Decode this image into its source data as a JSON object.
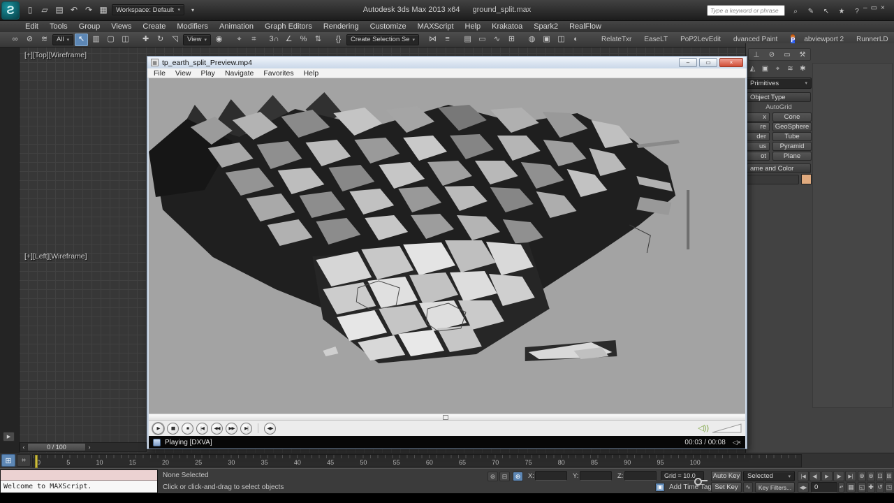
{
  "titlebar": {
    "app_title": "Autodesk 3ds Max  2013 x64",
    "filename": "ground_split.max",
    "workspace": "Workspace: Default",
    "search_placeholder": "Type a keyword or phrase"
  },
  "menubar": {
    "items": [
      "Edit",
      "Tools",
      "Group",
      "Views",
      "Create",
      "Modifiers",
      "Animation",
      "Graph Editors",
      "Rendering",
      "Customize",
      "MAXScript",
      "Help",
      "Krakatoa",
      "Spark2",
      "RealFlow"
    ]
  },
  "toolbar": {
    "filter_dropdown": "All",
    "coord_dropdown": "View",
    "selection_set_dropdown": "Create Selection Se",
    "plugins_left": [
      "RelateTxr",
      "EaseLT",
      "PoP2LevEdit",
      "dvanced Paint"
    ],
    "plugins_right": [
      "abviewport 2",
      "RunnerLD"
    ]
  },
  "viewport": {
    "top_label": "[+][Top][Wireframe]",
    "left_label": "[+][Left][Wireframe]",
    "time_slider_label": "0 / 100"
  },
  "trackbar": {
    "ticks": [
      "0",
      "5",
      "10",
      "15",
      "20",
      "25",
      "30",
      "35",
      "40",
      "45",
      "50",
      "55",
      "60",
      "65",
      "70",
      "75",
      "80",
      "85",
      "90",
      "95",
      "100"
    ]
  },
  "player": {
    "title": "tp_earth_split_Preview.mp4",
    "menu": [
      "File",
      "View",
      "Play",
      "Navigate",
      "Favorites",
      "Help"
    ],
    "status": "Playing [DXVA]",
    "time": "00:03 / 00:08"
  },
  "command_panel": {
    "dropdown": "Primitives",
    "object_type_header": "Object Type",
    "autogrid_label": "AutoGrid",
    "buttons_left_clipped": [
      "x",
      "re",
      "der",
      "us",
      "ot"
    ],
    "buttons_right": [
      "Cone",
      "GeoSphere",
      "Tube",
      "Pyramid",
      "Plane"
    ],
    "name_color_header": "ame and Color"
  },
  "statusbar": {
    "maxscript_text": "Welcome to MAXScript.",
    "selection_status": "None Selected",
    "prompt": "Click or click-and-drag to select objects",
    "x_label": "X:",
    "y_label": "Y:",
    "z_label": "Z:",
    "grid_label": "Grid = 10.0",
    "add_time_tag": "Add Time Tag",
    "auto_key": "Auto Key",
    "set_key": "Set Key",
    "selected_dropdown": "Selected",
    "key_filters": "Key Filters...",
    "frame_value": "0"
  },
  "colors": {
    "accent_blue": "#5d87b5",
    "close_red": "#cf4c36",
    "object_color_swatch": "#e0aa7e",
    "time_marker_yellow": "#cdbd3e",
    "listener_pink": "#ecd2d2"
  },
  "icons": {
    "logo": "Ƨ",
    "new_doc": "▯",
    "open": "▱",
    "save": "▤",
    "undo": "↶",
    "redo": "↷",
    "workspace": "▦",
    "caret": "▾",
    "search": "⌕",
    "comm": "✎",
    "cursor": "↖",
    "star": "★",
    "help": "?",
    "min": "–",
    "max": "▭",
    "close": "×",
    "link": "∞",
    "unlink": "⊘",
    "spacewarp": "≋",
    "select": "↖",
    "byname": "▥",
    "region": "▢",
    "crossing": "◫",
    "move": "✚",
    "rotate": "↻",
    "scale": "◹",
    "pivot": "◉",
    "manipulate": "⌖",
    "keyboard": "⌗",
    "snap": "3∩",
    "anglesnap": "∠",
    "percentsnap": "%",
    "spinnersnap": "⇅",
    "namedsets": "{}",
    "mirror": "⋈",
    "align": "≡",
    "layers": "▤",
    "ribbon": "▭",
    "curves": "∿",
    "schematic": "⊞",
    "material": "◍",
    "rendersetup": "▣",
    "renderframe": "◫",
    "render": "◐",
    "flame_p": "P",
    "tab_hierarchy": "⊥",
    "tab_motion": "⊘",
    "tab_display": "▭",
    "tab_utilities": "⚒",
    "cat_lights": "◭",
    "cat_cameras": "▣",
    "cat_helpers": "⌖",
    "cat_spacewarps": "≋",
    "cat_systems": "✱",
    "play": "▶",
    "pause": "▮▮",
    "stop": "■",
    "prev": "|◀",
    "rew": "◀◀",
    "ffwd": "▶▶",
    "next": "▶|",
    "step": "◀▶",
    "speaker": "◁))",
    "mute": "◁×",
    "media_doc": "▦",
    "gostart": "|◀",
    "prevframe": "◀|",
    "nextframe": "|▶",
    "goend": "▶|",
    "keymode": "◀▶",
    "isolate": "⊚",
    "lock": "⊟",
    "absoffset": "⊕",
    "timetag": "▣",
    "tangent": "∿",
    "spinner": "▴▾",
    "zoom": "⊕",
    "zoomall": "⊚",
    "extents": "⊡",
    "extentsall": "⊞",
    "zoomregion": "◱",
    "pan": "✚",
    "orbit": "↺",
    "maxviewport": "◳",
    "timeconfig": "▦",
    "vplayout": "⊞",
    "trackfilter": "⌗",
    "mini_arrow": "▶",
    "tslider_left": "‹",
    "tslider_right": "›"
  }
}
